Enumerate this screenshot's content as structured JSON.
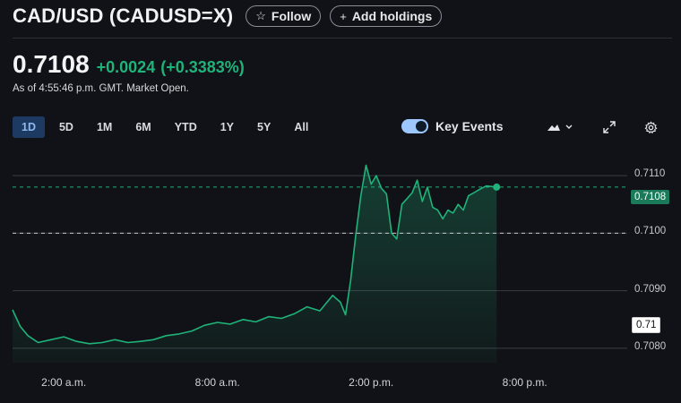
{
  "header": {
    "title": "CAD/USD (CADUSD=X)",
    "follow_label": "Follow",
    "add_holdings_label": "Add holdings",
    "follow_icon": "star-icon",
    "add_icon": "plus-icon"
  },
  "quote": {
    "price": "0.7108",
    "change": "+0.0024",
    "change_pct": "(+0.3383%)",
    "as_of": "As of 4:55:46 p.m. GMT. Market Open.",
    "positive_color": "#1fb37a"
  },
  "range_tabs": {
    "items": [
      "1D",
      "5D",
      "1M",
      "6M",
      "YTD",
      "1Y",
      "5Y",
      "All"
    ],
    "selected": "1D"
  },
  "toolbar": {
    "key_events_label": "Key Events",
    "key_events_on": true,
    "chart_type_icon": "mountain-chart-icon",
    "expand_icon": "expand-icon",
    "settings_icon": "gear-icon"
  },
  "chart_data": {
    "type": "area",
    "x_ticks": [
      "2:00 a.m.",
      "8:00 a.m.",
      "2:00 p.m.",
      "8:00 p.m."
    ],
    "y_ticks": [
      "0.7080",
      "0.7090",
      "0.7100",
      "0.7110"
    ],
    "ylim": [
      0.70775,
      0.71125
    ],
    "current_price_label": "0.7108",
    "previous_close_label": "0.71",
    "current_price": 0.7108,
    "previous_close": 0.71,
    "line_color": "#1fb37a",
    "series": [
      {
        "time_hours": [
          0.0,
          0.3,
          0.6,
          1.0,
          1.5,
          2.0,
          2.5,
          3.0,
          3.5,
          4.0,
          4.5,
          5.0,
          5.5,
          6.0,
          6.5,
          7.0,
          7.5,
          8.0,
          8.5,
          9.0,
          9.5,
          10.0,
          10.5,
          11.0,
          11.5,
          12.0,
          12.5,
          12.8,
          13.0,
          13.2,
          13.4,
          13.6,
          13.8,
          14.0,
          14.2,
          14.4,
          14.6,
          14.8,
          15.0,
          15.2,
          15.4,
          15.6,
          15.8,
          16.0,
          16.2,
          16.4,
          16.6,
          16.8,
          17.0,
          17.2,
          17.4,
          17.6,
          17.8,
          18.0,
          18.2,
          18.5,
          18.9
        ],
        "values": [
          0.70867,
          0.70838,
          0.70822,
          0.7081,
          0.70815,
          0.7082,
          0.70812,
          0.70808,
          0.7081,
          0.70815,
          0.7081,
          0.70812,
          0.70815,
          0.70822,
          0.70825,
          0.7083,
          0.7084,
          0.70845,
          0.70842,
          0.7085,
          0.70846,
          0.70855,
          0.70852,
          0.7086,
          0.70872,
          0.70865,
          0.70892,
          0.7088,
          0.70858,
          0.70918,
          0.70996,
          0.71065,
          0.71118,
          0.71085,
          0.711,
          0.71078,
          0.71068,
          0.71,
          0.7099,
          0.7105,
          0.7106,
          0.7107,
          0.71092,
          0.71055,
          0.7108,
          0.71045,
          0.7104,
          0.71025,
          0.7104,
          0.71035,
          0.7105,
          0.7104,
          0.71065,
          0.7107,
          0.71075,
          0.71082,
          0.7108
        ]
      }
    ]
  }
}
